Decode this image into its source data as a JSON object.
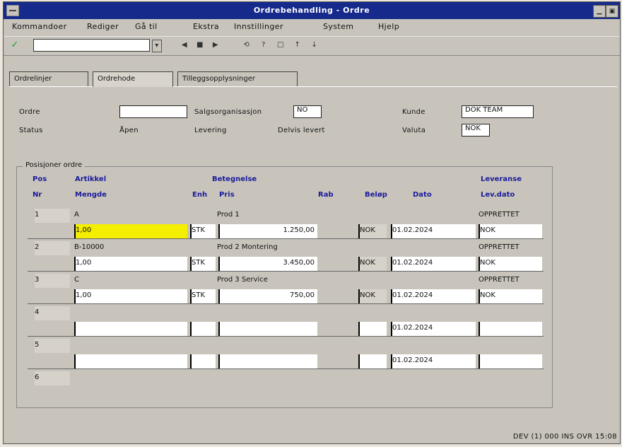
{
  "window": {
    "title": "Ordrebehandling - Ordre",
    "controls": [
      "minimize-icon",
      "maximize-icon"
    ]
  },
  "menu": [
    "Kommandoer",
    "Rediger",
    "Gå til",
    "Ekstra",
    "Innstillinger",
    "System",
    "Hjelp"
  ],
  "toolbar": {
    "command_value": "",
    "buttons": [
      "◀",
      "■",
      "▶",
      "⟲",
      "?",
      "□",
      "↑",
      "↓"
    ]
  },
  "tabs": [
    "Ordrelinjer",
    "Ordrehode",
    "Tilleggsopplysninger"
  ],
  "header": {
    "ordre_label": "Ordre",
    "ordre_value": "",
    "salgsorg_label": "Salgsorganisasjon",
    "salgsorg_value": "NO",
    "kunde_label": "Kunde",
    "kunde_value": "DOK TEAM",
    "status_label": "Status",
    "status_value": "Åpen",
    "levering_label": "Levering",
    "levering_value": "Delvis levert",
    "valuta_label": "Valuta",
    "valuta_value": "NOK"
  },
  "group": {
    "title": "Posisjoner ordre",
    "col_headers_top": [
      "Pos",
      "Artikkel",
      "Betegnelse",
      "Leveranse"
    ],
    "col_headers_bottom": [
      "Nr",
      "Mengde",
      "Enh",
      "Pris",
      "Rab",
      "Beløp",
      "Dato",
      "Lev.dato"
    ],
    "rows": [
      {
        "pos": "1",
        "artikkel": "A",
        "betegnelse": "Prod 1",
        "mengde": "1,00",
        "enhet": "STK",
        "pris": "1.250,00",
        "valuta": "NOK",
        "dato": "01.02.2024",
        "ref": "NOK",
        "status": "OPPRETTET"
      },
      {
        "pos": "2",
        "artikkel": "B-10000",
        "betegnelse": "Prod 2 Montering",
        "mengde": "1,00",
        "enhet": "STK",
        "pris": "3.450,00",
        "valuta": "NOK",
        "dato": "01.02.2024",
        "ref": "NOK",
        "status": "OPPRETTET"
      },
      {
        "pos": "3",
        "artikkel": "C",
        "betegnelse": "Prod 3 Service",
        "mengde": "1,00",
        "enhet": "STK",
        "pris": "750,00",
        "valuta": "NOK",
        "dato": "01.02.2024",
        "ref": "NOK",
        "status": "OPPRETTET"
      },
      {
        "pos": "4",
        "artikkel": "",
        "betegnelse": "",
        "mengde": "",
        "enhet": "",
        "pris": "",
        "valuta": "",
        "dato": "01.02.2024",
        "ref": "",
        "status": ""
      },
      {
        "pos": "5",
        "artikkel": "",
        "betegnelse": "",
        "mengde": "",
        "enhet": "",
        "pris": "",
        "valuta": "",
        "dato": "01.02.2024",
        "ref": "",
        "status": ""
      },
      {
        "pos": "6",
        "artikkel": "",
        "betegnelse": "",
        "mengde": "",
        "enhet": "",
        "pris": "",
        "valuta": "",
        "dato": "",
        "ref": "",
        "status": ""
      }
    ]
  },
  "status": "DEV (1) 000 INS OVR 15:08"
}
